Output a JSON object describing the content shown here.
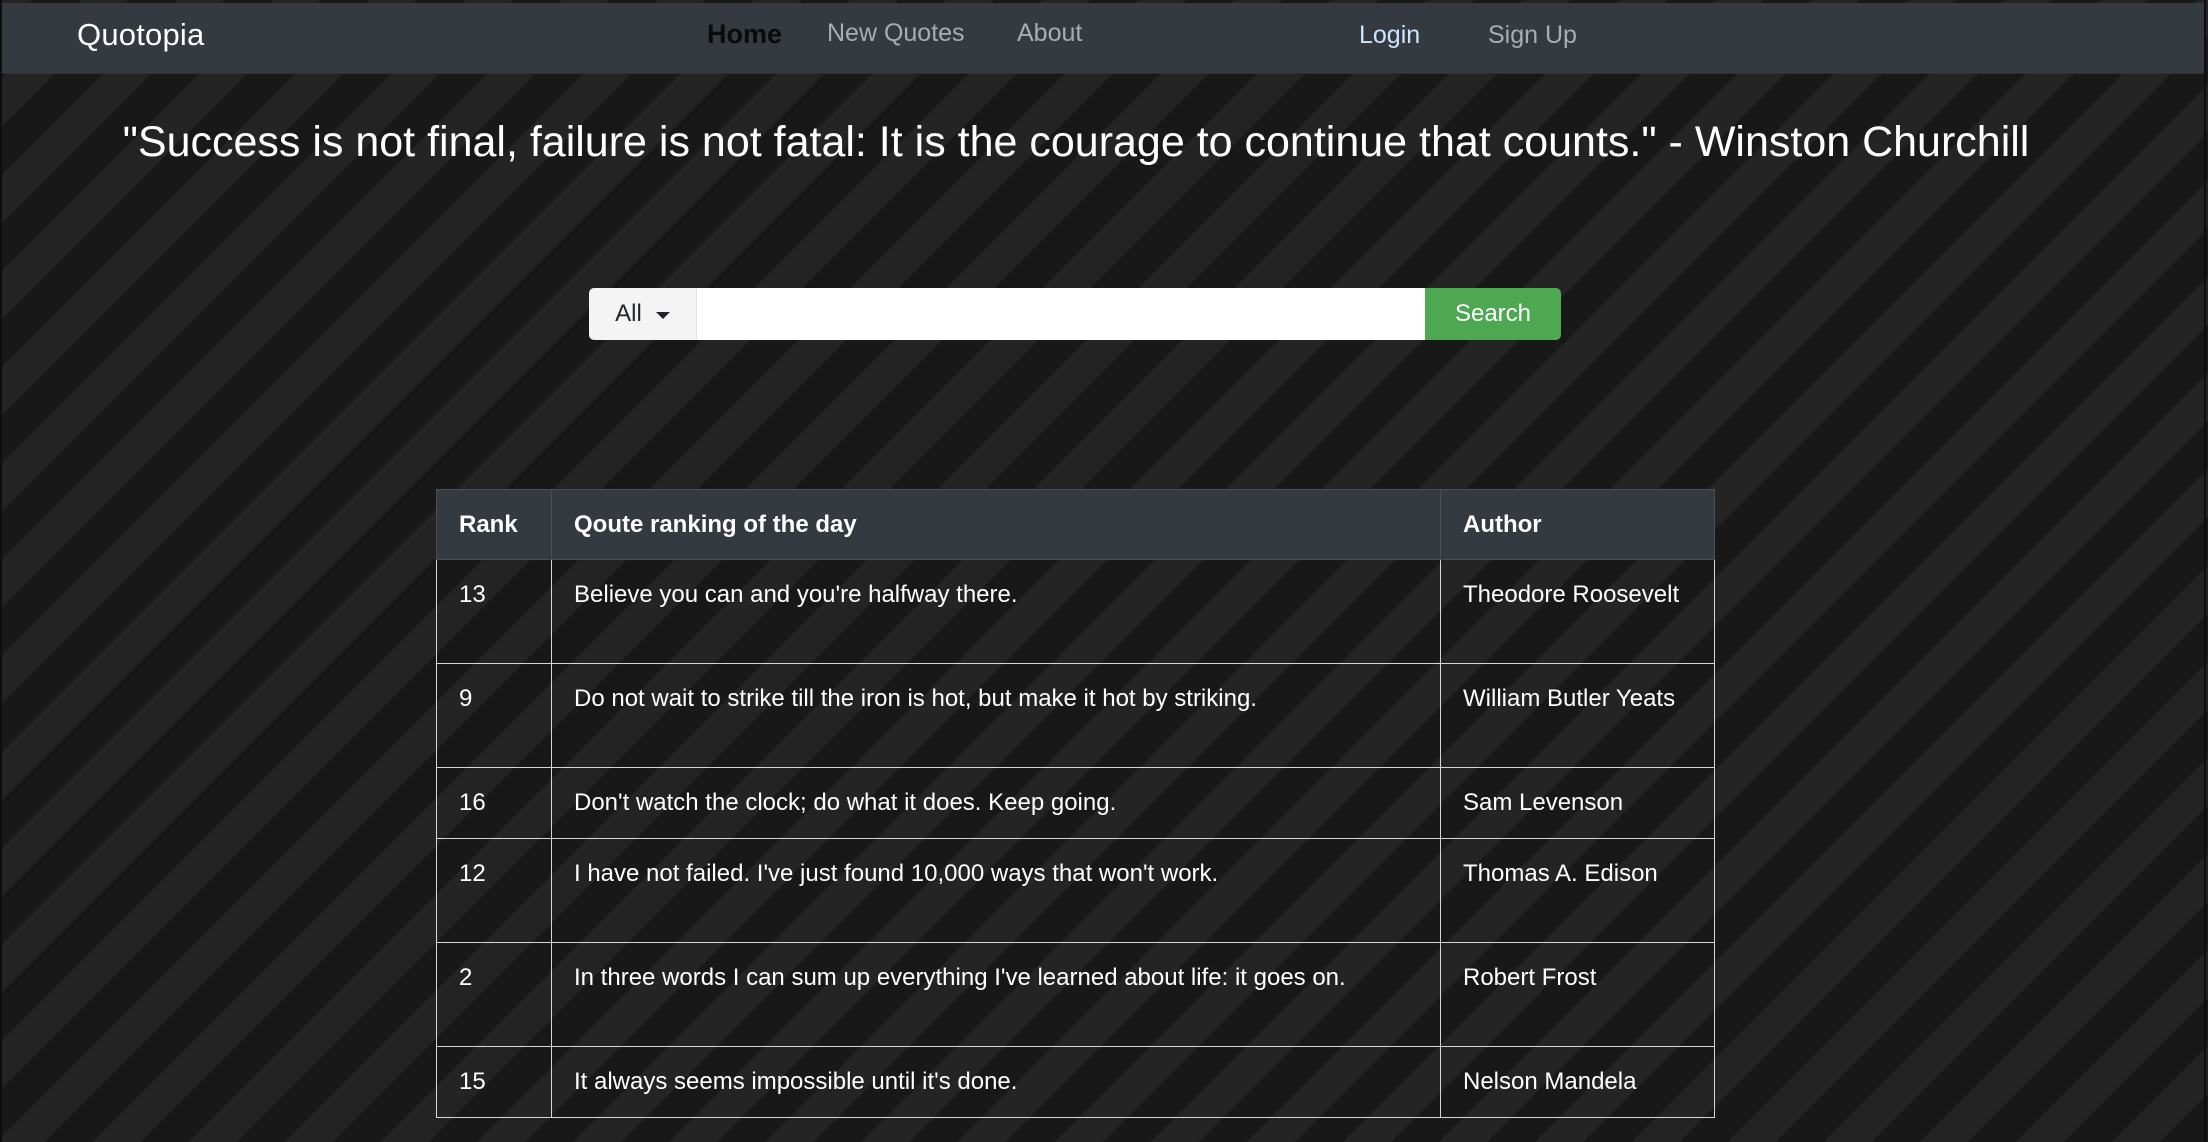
{
  "navbar": {
    "brand": "Quotopia",
    "links": {
      "home": "Home",
      "new_quotes": "New Quotes",
      "about": "About"
    },
    "auth": {
      "login": "Login",
      "signup": "Sign Up"
    }
  },
  "quote_of_day": "\"Success is not final, failure is not fatal: It is the courage to continue that counts.\" - Winston Churchill",
  "search": {
    "filter_selected": "All",
    "input_value": "",
    "button_label": "Search"
  },
  "table": {
    "headers": {
      "rank": "Rank",
      "quote": "Qoute ranking of the day",
      "author": "Author"
    },
    "rows": [
      {
        "rank": "13",
        "quote": "Believe you can and you're halfway there.",
        "author": "Theodore Roosevelt"
      },
      {
        "rank": "9",
        "quote": "Do not wait to strike till the iron is hot, but make it hot by striking.",
        "author": "William Butler Yeats"
      },
      {
        "rank": "16",
        "quote": "Don't watch the clock; do what it does. Keep going.",
        "author": "Sam Levenson"
      },
      {
        "rank": "12",
        "quote": "I have not failed. I've just found 10,000 ways that won't work.",
        "author": "Thomas A. Edison"
      },
      {
        "rank": "2",
        "quote": "In three words I can sum up everything I've learned about life: it goes on.",
        "author": "Robert Frost"
      },
      {
        "rank": "15",
        "quote": "It always seems impossible until it's done.",
        "author": "Nelson Mandela"
      }
    ]
  },
  "colors": {
    "navbar_bg": "#343a40",
    "search_button": "#4ea852"
  }
}
